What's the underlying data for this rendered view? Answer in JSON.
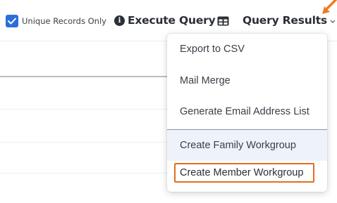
{
  "toolbar": {
    "unique_records_label": "Unique Records Only",
    "unique_records_checked": true,
    "execute_query_label": "Execute Query",
    "query_results_label": "Query Results"
  },
  "menu": {
    "items": [
      {
        "label": "Export to CSV"
      },
      {
        "label": "Mail Merge"
      },
      {
        "label": "Generate Email Address List"
      },
      {
        "label": "Create Family Workgroup"
      },
      {
        "label": "Create Member Workgroup"
      }
    ]
  },
  "colors": {
    "checkbox": "#2a6fdb",
    "highlight": "#e36f1e",
    "arrow": "#f07a21",
    "hover": "#eef3fb"
  }
}
